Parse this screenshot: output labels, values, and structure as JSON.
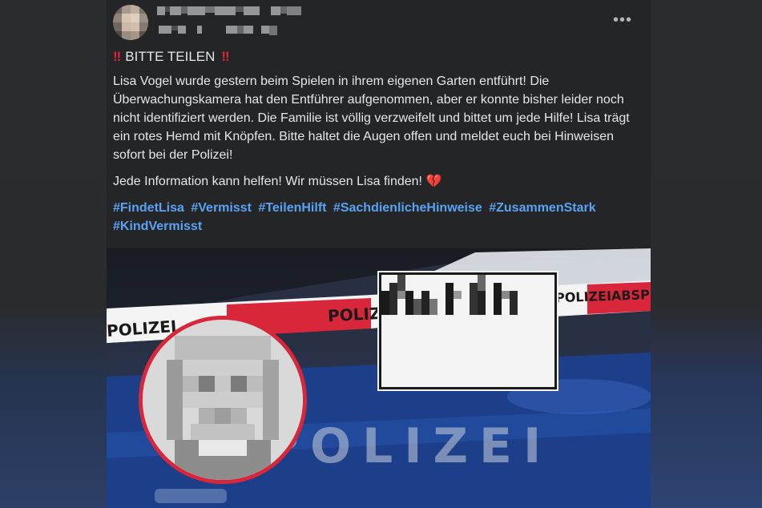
{
  "post": {
    "author_name": "",
    "meta": "",
    "headline": "BITTE TEILEN",
    "paragraph1": "Lisa Vogel wurde gestern beim Spielen in ihrem eigenen Garten entführt! Die Überwachungskamera hat den Entführer aufgenommen, aber er konnte bisher leider noch nicht identifiziert werden. Die Familie ist völlig verzweifelt und bittet um jede Hilfe! Lisa trägt ein rotes Hemd mit Knöpfen. Bitte haltet die Augen offen und meldet euch bei Hinweisen sofort bei der Polizei!",
    "paragraph2": "Jede Information kann helfen! Wir müssen Lisa finden!",
    "hashtags": [
      "#FindetLisa",
      "#Vermisst",
      "#TeilenHilft",
      "#SachdienlicheHinweise",
      "#ZusammenStark",
      "#KindVermisst"
    ]
  },
  "icons": {
    "more": "more-options-icon",
    "alarm": "double-exclamation-icon",
    "heart": "broken-heart-icon"
  },
  "glyphs": {
    "more": "•••",
    "bang": "‼",
    "heart": "💔"
  },
  "image": {
    "car_text": "POLIZEI",
    "tape_text_left": "POLIZEI",
    "tape_text_mid": "POLIZEI",
    "tape_text_right": "POLIZEIABSPE"
  },
  "colors": {
    "background": "#242526",
    "text": "#e4e6eb",
    "hashtag": "#5aa2f4",
    "accent_red": "#e0243b"
  }
}
